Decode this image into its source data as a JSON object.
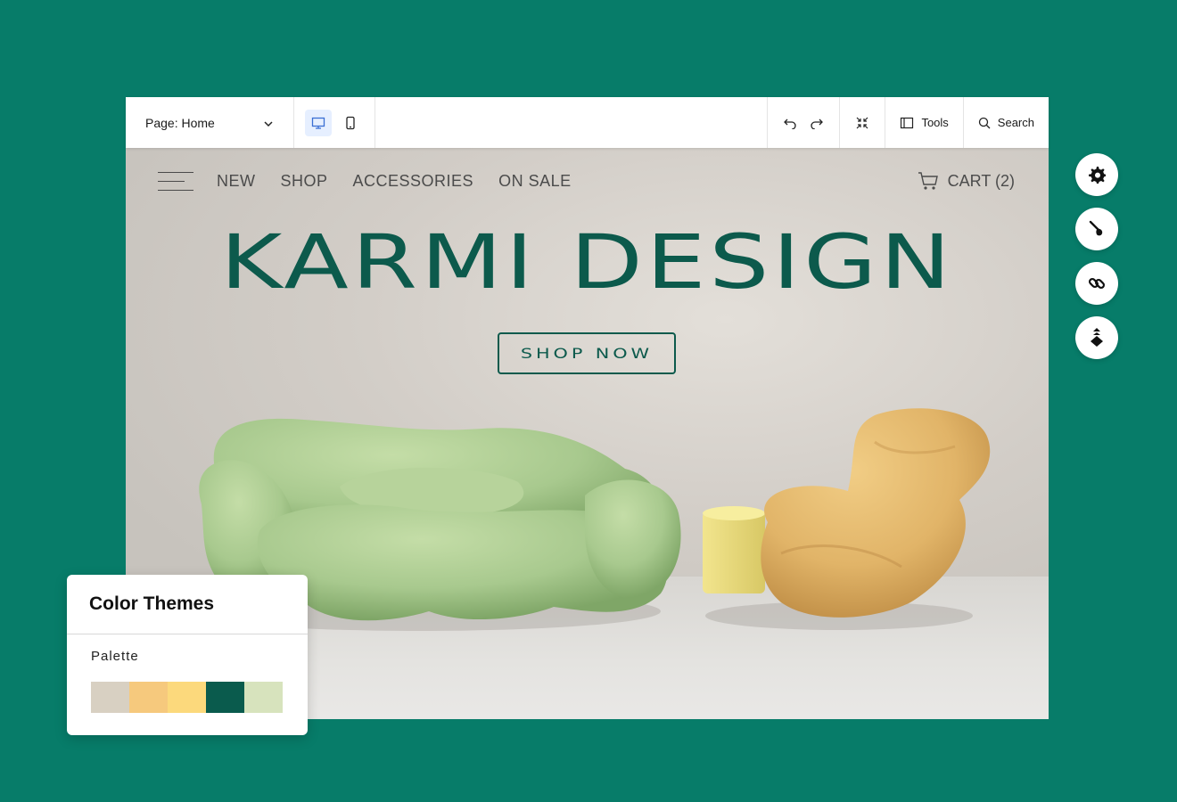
{
  "toolbar": {
    "page_label": "Page: Home",
    "tools_label": "Tools",
    "search_label": "Search"
  },
  "site": {
    "nav": [
      "NEW",
      "SHOP",
      "ACCESSORIES",
      "ON SALE"
    ],
    "cart_label": "CART (2)",
    "hero_title": "KARMI DESIGN",
    "cta_label": "SHOP NOW"
  },
  "side_tools": [
    "gear-icon",
    "brush-icon",
    "link-icon",
    "layers-icon"
  ],
  "themes_panel": {
    "title": "Color Themes",
    "palette_label": "Palette",
    "colors": [
      "#d8d0c2",
      "#f6c97d",
      "#fcd97c",
      "#0a5b4d",
      "#d7e3bd"
    ]
  },
  "colors": {
    "background": "#077c69",
    "brand_text": "#0c5a4c",
    "sofa": "#a8c98e",
    "chair": "#e1b468"
  }
}
